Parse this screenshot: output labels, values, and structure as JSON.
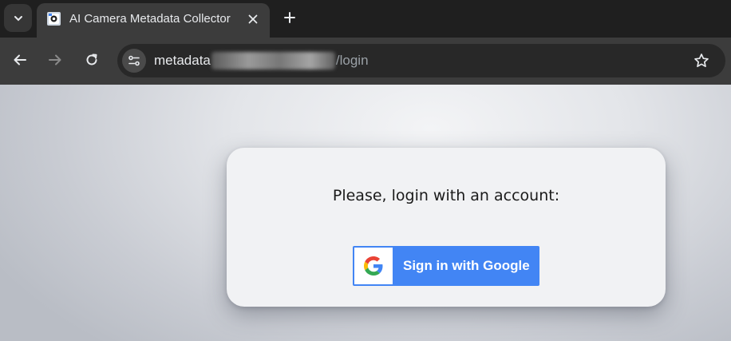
{
  "browser": {
    "tab": {
      "title": "AI Camera Metadata Collector"
    },
    "address_bar": {
      "url_prefix": "metadata",
      "url_path": "/login"
    }
  },
  "page": {
    "prompt": "Please, login with an account:",
    "google_button_label": "Sign in with Google"
  },
  "colors": {
    "google_blue": "#4285f4",
    "card_background": "#f1f2f4",
    "toolbar": "#3c3c3c"
  }
}
